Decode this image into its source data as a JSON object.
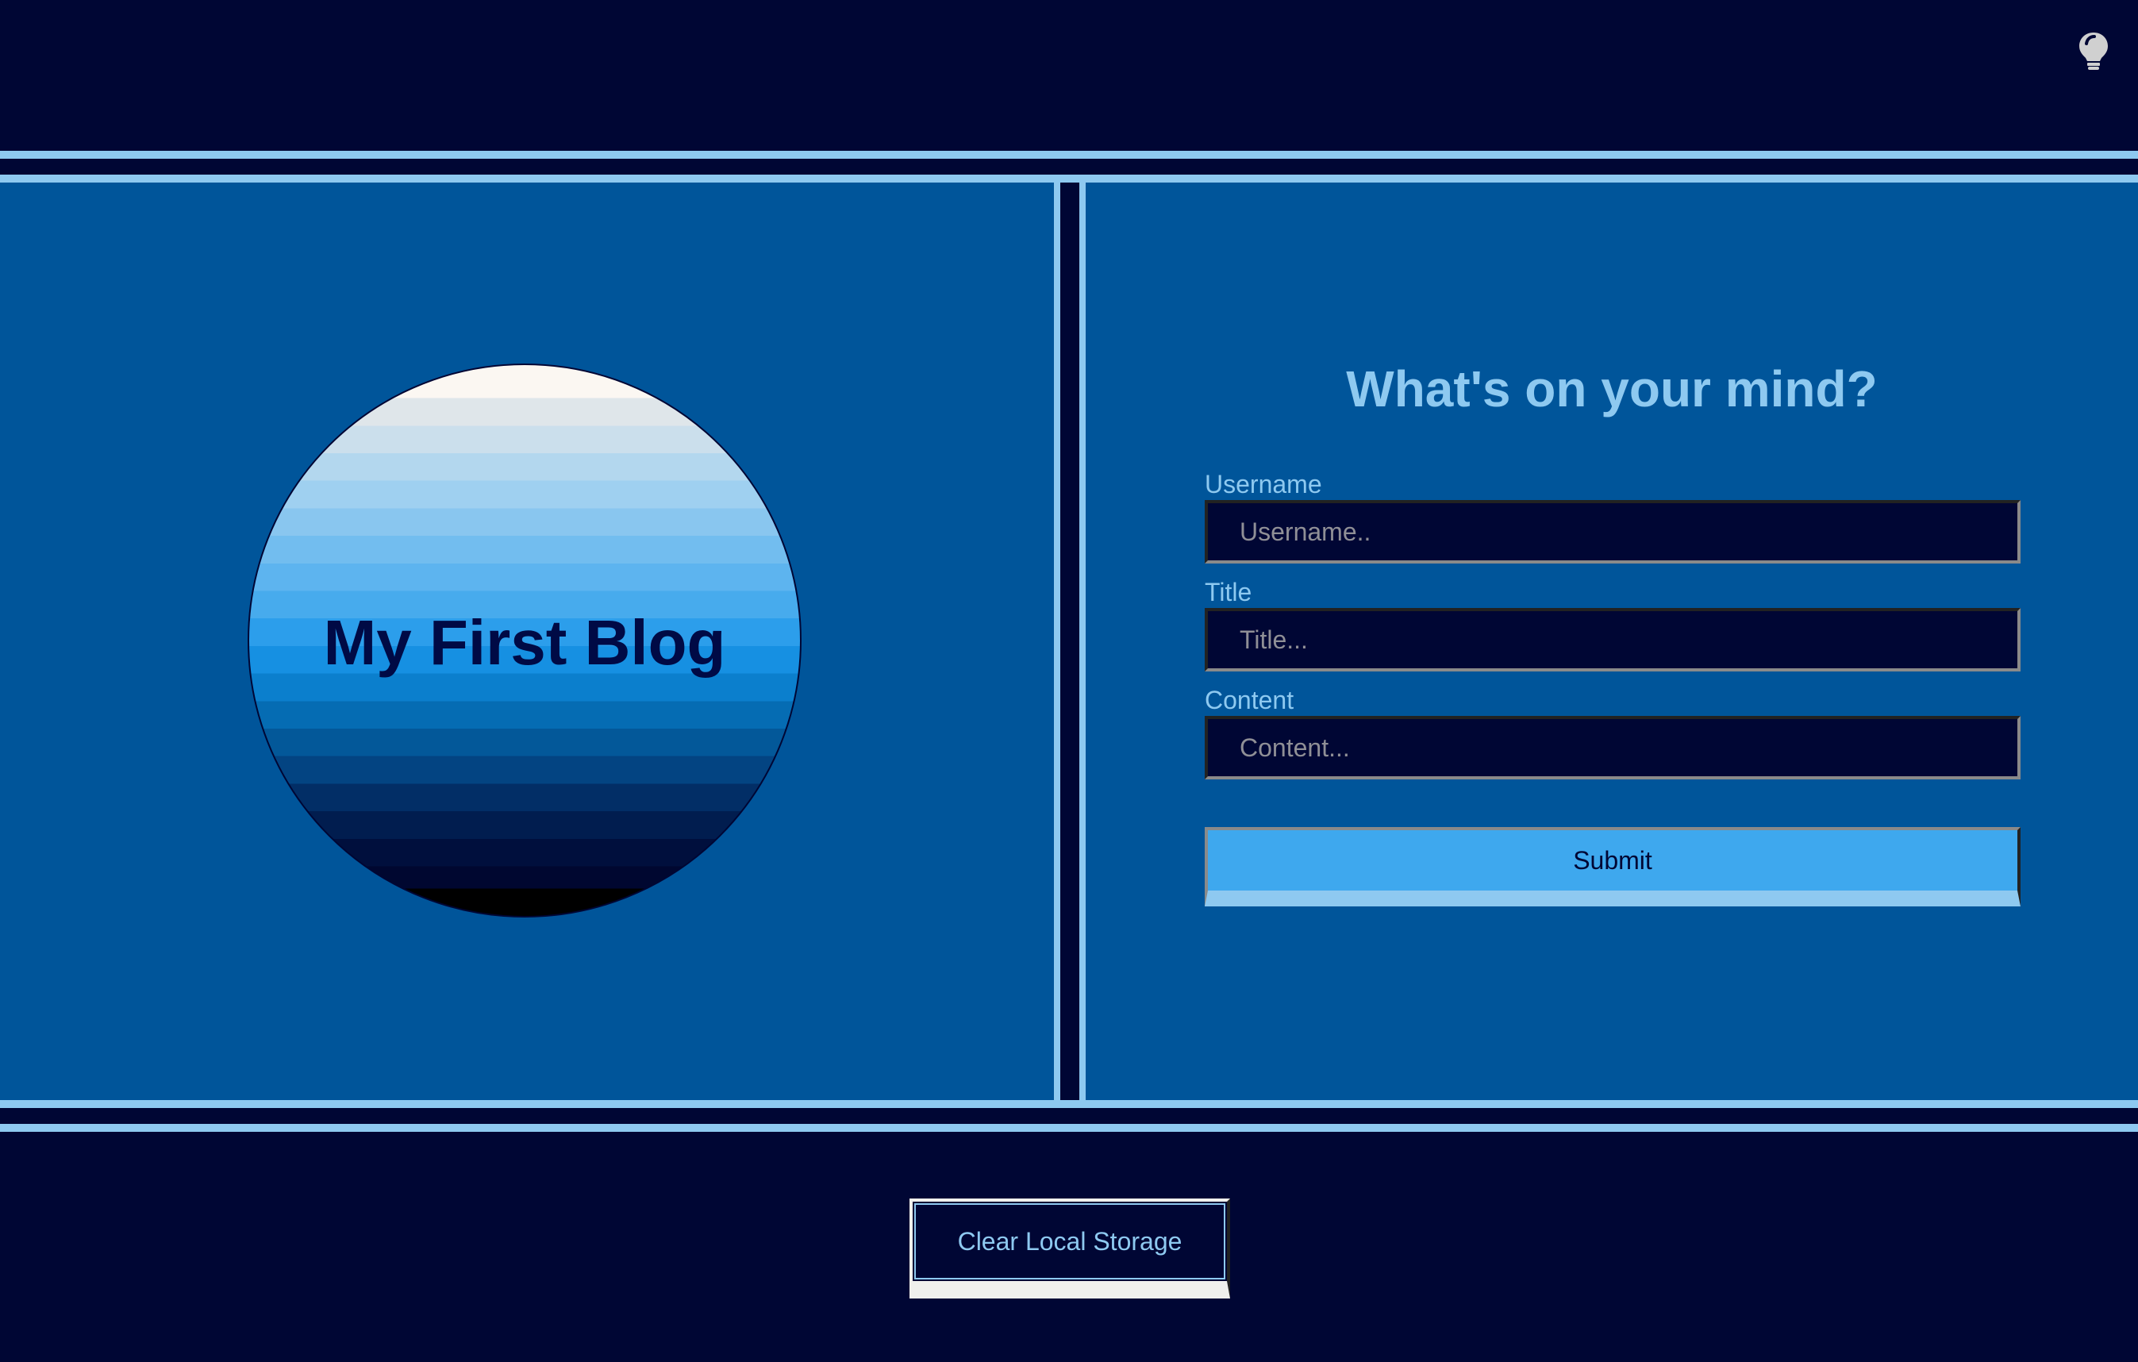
{
  "header": {
    "theme_toggle_icon": "lightbulb-icon"
  },
  "hero": {
    "title": "My First Blog"
  },
  "form": {
    "heading": "What's on your mind?",
    "username": {
      "label": "Username",
      "placeholder": "Username..",
      "value": ""
    },
    "title": {
      "label": "Title",
      "placeholder": "Title...",
      "value": ""
    },
    "content": {
      "label": "Content",
      "placeholder": "Content...",
      "value": ""
    },
    "submit_label": "Submit"
  },
  "footer": {
    "clear_label": "Clear Local Storage"
  },
  "colors": {
    "background": "#000634",
    "panel": "#00559a",
    "accent": "#8ec9f0",
    "button": "#3ea8ee"
  }
}
